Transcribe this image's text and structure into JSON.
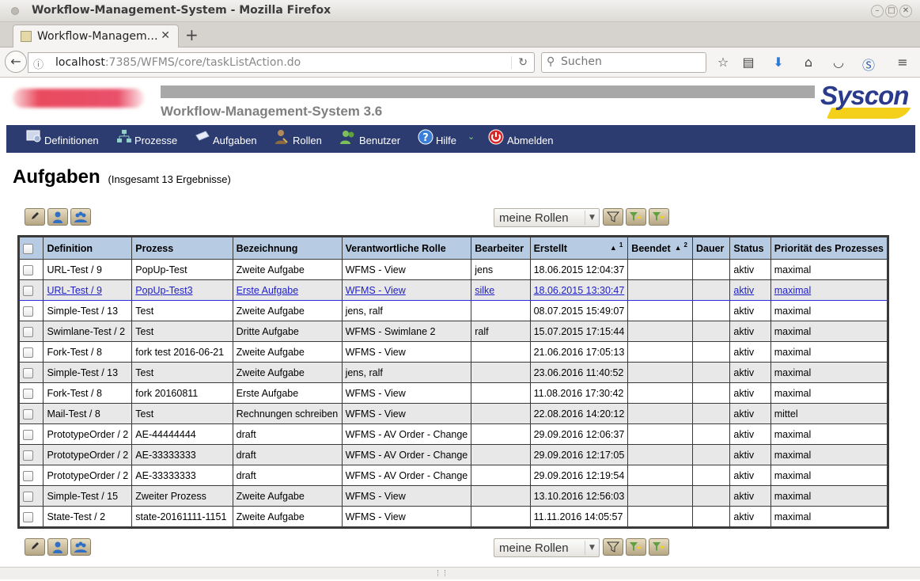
{
  "window": {
    "title": "Workflow-Management-System - Mozilla Firefox"
  },
  "tab": {
    "title": "Workflow-Managem…",
    "close": "✕",
    "new_tab": "+"
  },
  "nav": {
    "url_host": "localhost",
    "url_rest": ":7385/WFMS/core/taskListAction.do",
    "search_placeholder": "Suchen"
  },
  "header": {
    "app_title": "Workflow-Management-System 3.6",
    "brand": "Syscon"
  },
  "menu": [
    {
      "label": "Definitionen",
      "icon": "definitions-icon"
    },
    {
      "label": "Prozesse",
      "icon": "process-icon"
    },
    {
      "label": "Aufgaben",
      "icon": "tasks-icon"
    },
    {
      "label": "Rollen",
      "icon": "roles-icon"
    },
    {
      "label": "Benutzer",
      "icon": "users-icon"
    },
    {
      "label": "Hilfe",
      "icon": "help-icon"
    },
    {
      "label": "Abmelden",
      "icon": "logout-icon"
    }
  ],
  "page": {
    "heading": "Aufgaben",
    "result_count": "(Insgesamt 13 Ergebnisse)"
  },
  "filter": {
    "selected": "meine Rollen"
  },
  "table": {
    "headers": {
      "definition": "Definition",
      "prozess": "Prozess",
      "bezeichnung": "Bezeichnung",
      "rolle": "Verantwortliche Rolle",
      "bearbeiter": "Bearbeiter",
      "erstellt": "Erstellt",
      "erstellt_sort": "1",
      "beendet": "Beendet",
      "beendet_sort": "2",
      "dauer": "Dauer",
      "status": "Status",
      "prioritaet": "Priorität des Prozesses"
    },
    "rows": [
      {
        "definition": "URL-Test / 9",
        "prozess": "PopUp-Test",
        "bezeichnung": "Zweite Aufgabe",
        "rolle": "WFMS - View",
        "bearbeiter": "jens",
        "erstellt": "18.06.2015 12:04:37",
        "beendet": "",
        "dauer": "",
        "status": "aktiv",
        "prioritaet": "maximal"
      },
      {
        "definition": "URL-Test / 9",
        "prozess": "PopUp-Test3",
        "bezeichnung": "Erste Aufgabe",
        "rolle": "WFMS - View",
        "bearbeiter": "silke",
        "erstellt": "18.06.2015 13:30:47",
        "beendet": "",
        "dauer": "",
        "status": "aktiv",
        "prioritaet": "maximal"
      },
      {
        "definition": "Simple-Test / 13",
        "prozess": "Test",
        "bezeichnung": "Zweite Aufgabe",
        "rolle": "jens, ralf",
        "bearbeiter": "",
        "erstellt": "08.07.2015 15:49:07",
        "beendet": "",
        "dauer": "",
        "status": "aktiv",
        "prioritaet": "maximal"
      },
      {
        "definition": "Swimlane-Test / 2",
        "prozess": "Test",
        "bezeichnung": "Dritte Aufgabe",
        "rolle": "WFMS - Swimlane 2",
        "bearbeiter": "ralf",
        "erstellt": "15.07.2015 17:15:44",
        "beendet": "",
        "dauer": "",
        "status": "aktiv",
        "prioritaet": "maximal"
      },
      {
        "definition": "Fork-Test / 8",
        "prozess": "fork test 2016-06-21",
        "bezeichnung": "Zweite Aufgabe",
        "rolle": "WFMS - View",
        "bearbeiter": "",
        "erstellt": "21.06.2016 17:05:13",
        "beendet": "",
        "dauer": "",
        "status": "aktiv",
        "prioritaet": "maximal"
      },
      {
        "definition": "Simple-Test / 13",
        "prozess": "Test",
        "bezeichnung": "Zweite Aufgabe",
        "rolle": "jens, ralf",
        "bearbeiter": "",
        "erstellt": "23.06.2016 11:40:52",
        "beendet": "",
        "dauer": "",
        "status": "aktiv",
        "prioritaet": "maximal"
      },
      {
        "definition": "Fork-Test / 8",
        "prozess": "fork 20160811",
        "bezeichnung": "Erste Aufgabe",
        "rolle": "WFMS - View",
        "bearbeiter": "",
        "erstellt": "11.08.2016 17:30:42",
        "beendet": "",
        "dauer": "",
        "status": "aktiv",
        "prioritaet": "maximal"
      },
      {
        "definition": "Mail-Test / 8",
        "prozess": "Test",
        "bezeichnung": "Rechnungen schreiben",
        "rolle": "WFMS - View",
        "bearbeiter": "",
        "erstellt": "22.08.2016 14:20:12",
        "beendet": "",
        "dauer": "",
        "status": "aktiv",
        "prioritaet": "mittel"
      },
      {
        "definition": "PrototypeOrder / 2",
        "prozess": "AE-44444444",
        "bezeichnung": "draft",
        "rolle": "WFMS - AV Order - Change",
        "bearbeiter": "",
        "erstellt": "29.09.2016 12:06:37",
        "beendet": "",
        "dauer": "",
        "status": "aktiv",
        "prioritaet": "maximal"
      },
      {
        "definition": "PrototypeOrder / 2",
        "prozess": "AE-33333333",
        "bezeichnung": "draft",
        "rolle": "WFMS - AV Order - Change",
        "bearbeiter": "",
        "erstellt": "29.09.2016 12:17:05",
        "beendet": "",
        "dauer": "",
        "status": "aktiv",
        "prioritaet": "maximal"
      },
      {
        "definition": "PrototypeOrder / 2",
        "prozess": "AE-33333333",
        "bezeichnung": "draft",
        "rolle": "WFMS - AV Order - Change",
        "bearbeiter": "",
        "erstellt": "29.09.2016 12:19:54",
        "beendet": "",
        "dauer": "",
        "status": "aktiv",
        "prioritaet": "maximal"
      },
      {
        "definition": "Simple-Test / 15",
        "prozess": "Zweiter Prozess",
        "bezeichnung": "Zweite Aufgabe",
        "rolle": "WFMS - View",
        "bearbeiter": "",
        "erstellt": "13.10.2016 12:56:03",
        "beendet": "",
        "dauer": "",
        "status": "aktiv",
        "prioritaet": "maximal"
      },
      {
        "definition": "State-Test / 2",
        "prozess": "state-20161111-1151",
        "bezeichnung": "Zweite Aufgabe",
        "rolle": "WFMS - View",
        "bearbeiter": "",
        "erstellt": "11.11.2016 14:05:57",
        "beendet": "",
        "dauer": "",
        "status": "aktiv",
        "prioritaet": "maximal"
      }
    ],
    "highlighted_row": 1
  },
  "colors": {
    "menu_bg": "#2d3c70",
    "header_bg": "#b7cbe3",
    "brand_blue": "#2a3a8c",
    "brand_yellow": "#f4d01a",
    "link": "#2020c8"
  }
}
